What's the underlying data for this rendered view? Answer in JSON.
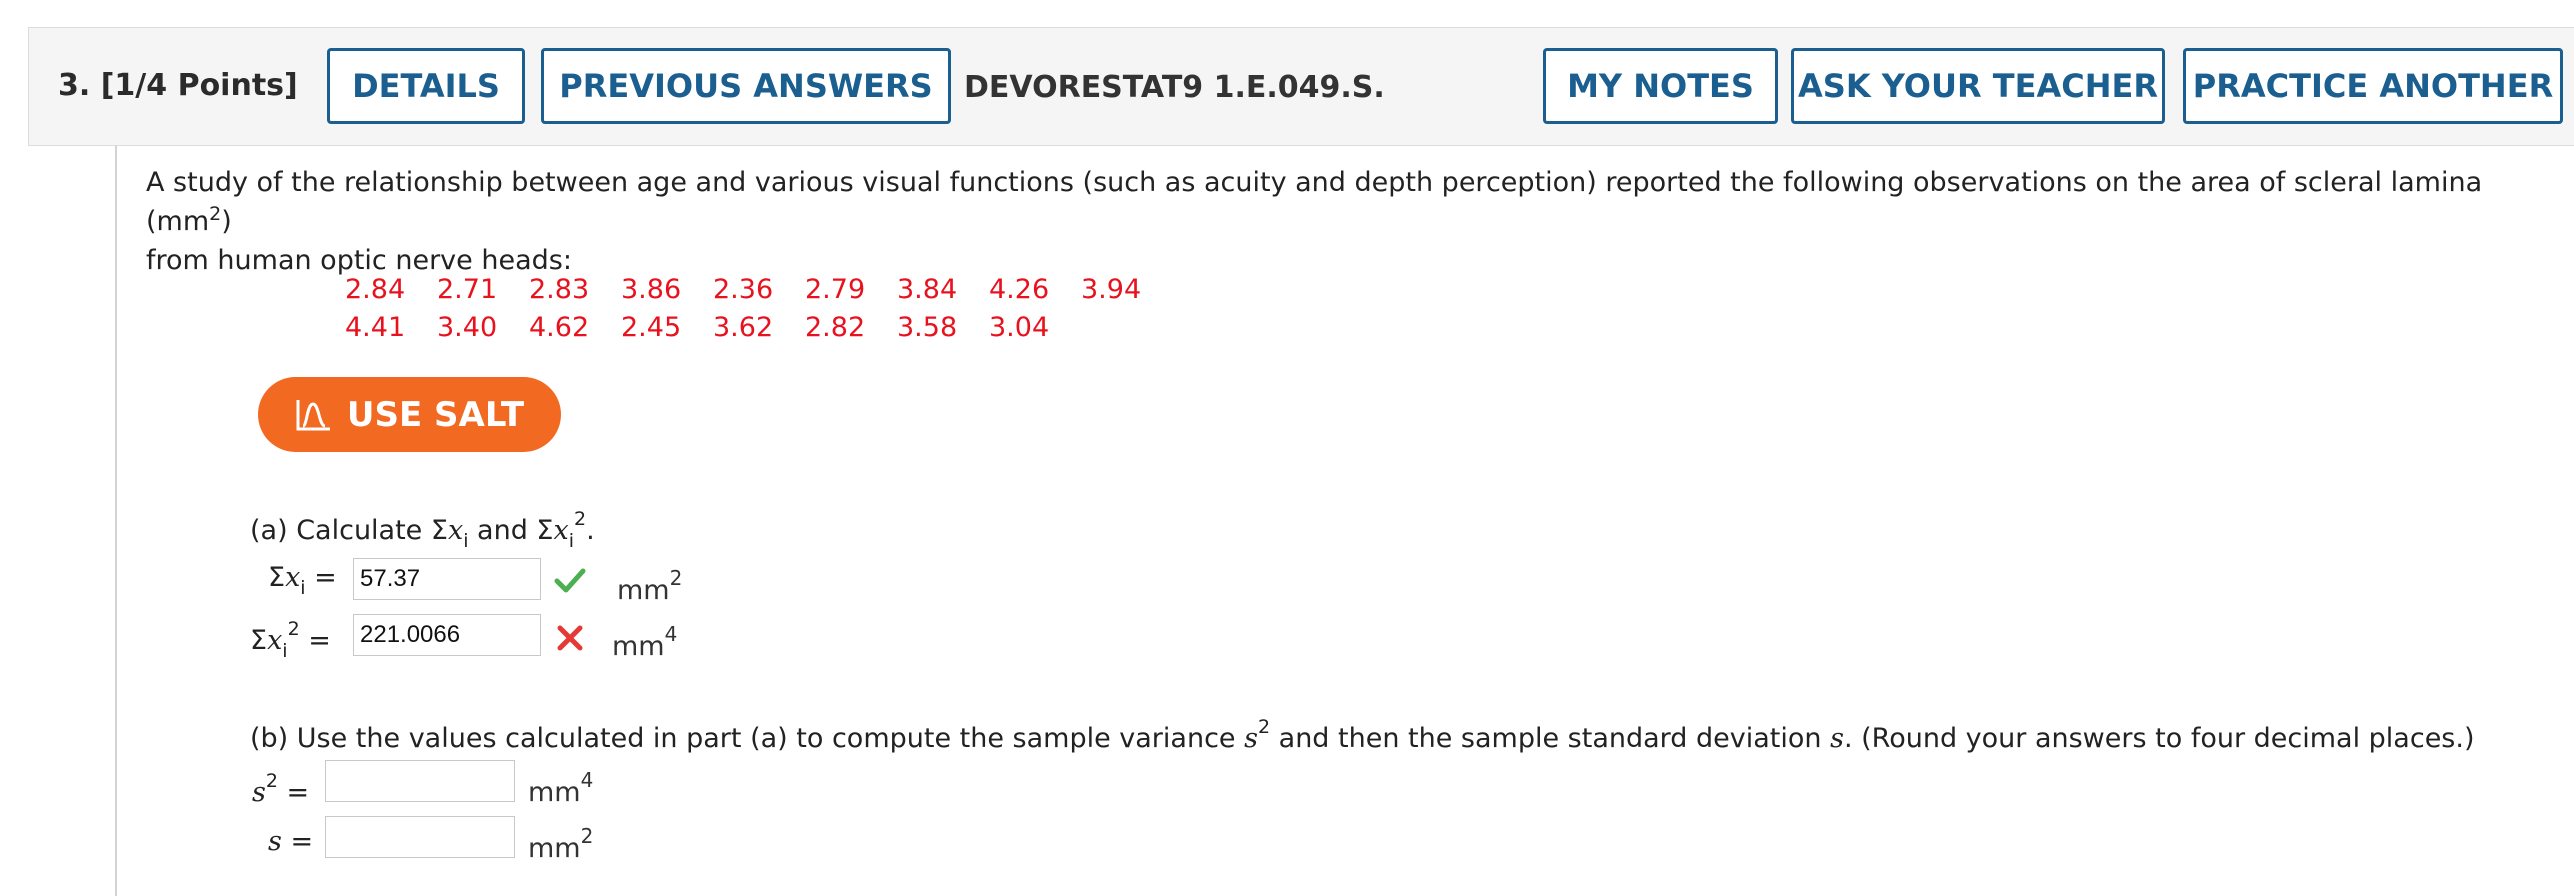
{
  "header": {
    "question_number": "3. [1/4 Points]",
    "details_label": "DETAILS",
    "previous_answers_label": "PREVIOUS ANSWERS",
    "assignment_id": "DEVORESTAT9 1.E.049.S.",
    "my_notes_label": "MY NOTES",
    "ask_teacher_label": "ASK YOUR TEACHER",
    "practice_another_label": "PRACTICE ANOTHER"
  },
  "problem": {
    "intro_text": "A study of the relationship between age and various visual functions (such as acuity and depth perception) reported the following observations on the area of scleral lamina (mm",
    "intro_sup": "2",
    "intro_close": ")",
    "intro_line2": "from human optic nerve heads:",
    "data_row1": [
      "2.84",
      "2.71",
      "2.83",
      "3.86",
      "2.36",
      "2.79",
      "3.84",
      "4.26",
      "3.94"
    ],
    "data_row2": [
      "4.41",
      "3.40",
      "4.62",
      "2.45",
      "3.62",
      "2.82",
      "3.58",
      "3.04"
    ]
  },
  "salt_button": {
    "label": "USE SALT"
  },
  "part_a": {
    "prompt_prefix": "(a) Calculate Σ",
    "prompt_and": " and Σ",
    "prompt_end": ".",
    "sum_x_value": "57.37",
    "sum_x_status": "correct",
    "sum_x_unit": "mm",
    "sum_x_unit_exp": "2",
    "sum_x2_value": "221.0066",
    "sum_x2_status": "incorrect",
    "sum_x2_unit": "mm",
    "sum_x2_unit_exp": "4"
  },
  "part_b": {
    "prompt_prefix": "(b) Use the values calculated in part (a) to compute the sample variance ",
    "prompt_mid": " and then the sample standard deviation ",
    "prompt_end": ". (Round your answers to four decimal places.)",
    "s2_value": "",
    "s2_unit": "mm",
    "s2_unit_exp": "4",
    "s_value": "",
    "s_unit": "mm",
    "s_unit_exp": "2"
  },
  "colors": {
    "accent_blue": "#1a5f8f",
    "data_red": "#e8121e",
    "salt_orange": "#f26a21",
    "correct_green": "#4caf50",
    "incorrect_red": "#e53935"
  }
}
